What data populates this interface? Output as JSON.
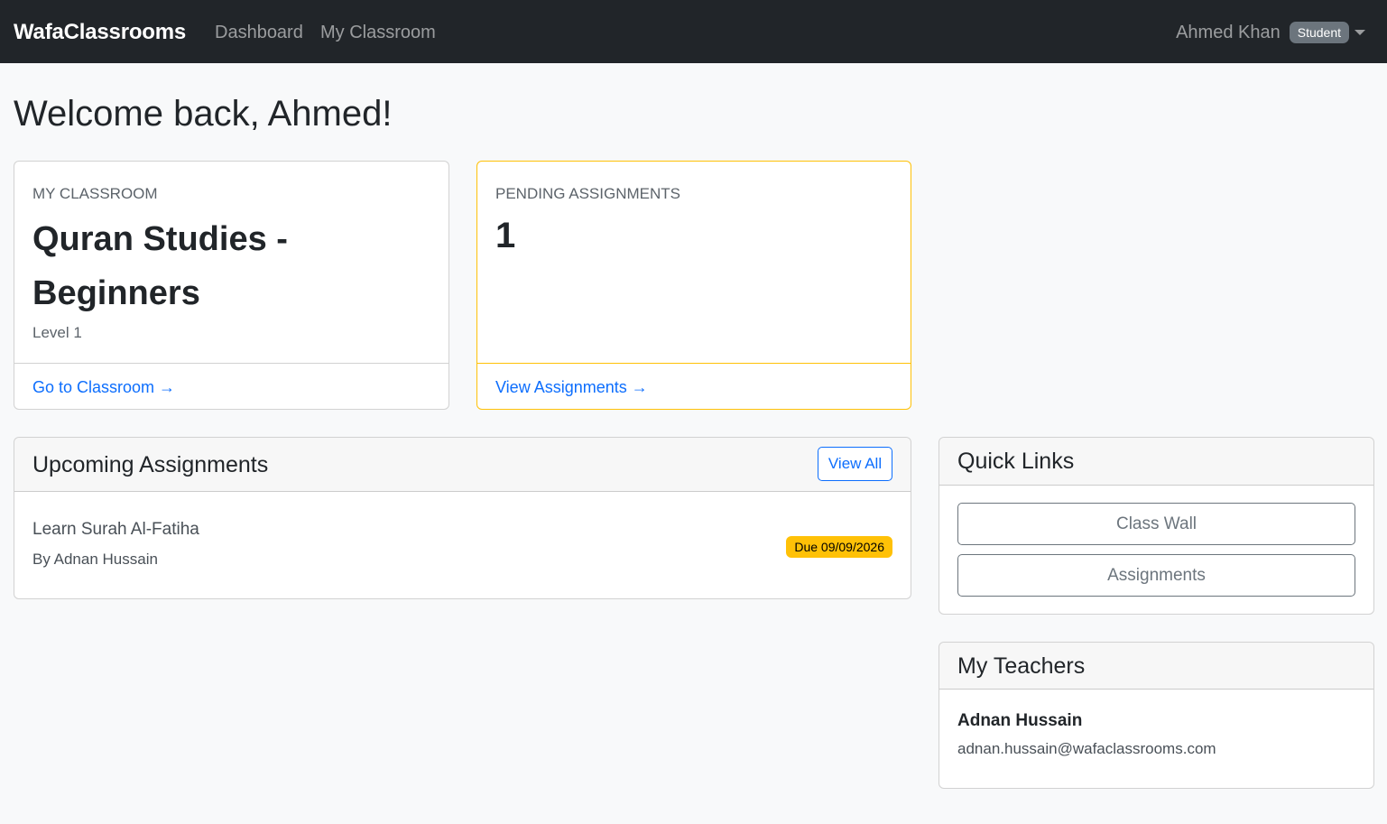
{
  "navbar": {
    "brand": "WafaClassrooms",
    "links": [
      "Dashboard",
      "My Classroom"
    ],
    "user_name": "Ahmed Khan",
    "role_badge": "Student"
  },
  "welcome": "Welcome back, Ahmed!",
  "classroom_card": {
    "label": "MY CLASSROOM",
    "title": "Quran Studies - Beginners",
    "subtitle": "Level 1",
    "link": "Go to Classroom →"
  },
  "pending_card": {
    "label": "PENDING ASSIGNMENTS",
    "count": "1",
    "link": "View Assignments →",
    "accent_color": "#ffc107"
  },
  "upcoming": {
    "title": "Upcoming Assignments",
    "view_all": "View All",
    "items": [
      {
        "title": "Learn Surah Al-Fatiha",
        "by": "By Adnan Hussain",
        "due": "Due 09/09/2026"
      }
    ]
  },
  "quick_links": {
    "title": "Quick Links",
    "buttons": [
      "Class Wall",
      "Assignments"
    ]
  },
  "teachers": {
    "title": "My Teachers",
    "items": [
      {
        "name": "Adnan Hussain",
        "email": "adnan.hussain@wafaclassrooms.com"
      }
    ]
  },
  "colors": {
    "navbar_bg": "#212529",
    "page_bg": "#f8f9fa",
    "primary": "#0d6efd",
    "warning": "#ffc107",
    "secondary": "#6c757d"
  }
}
